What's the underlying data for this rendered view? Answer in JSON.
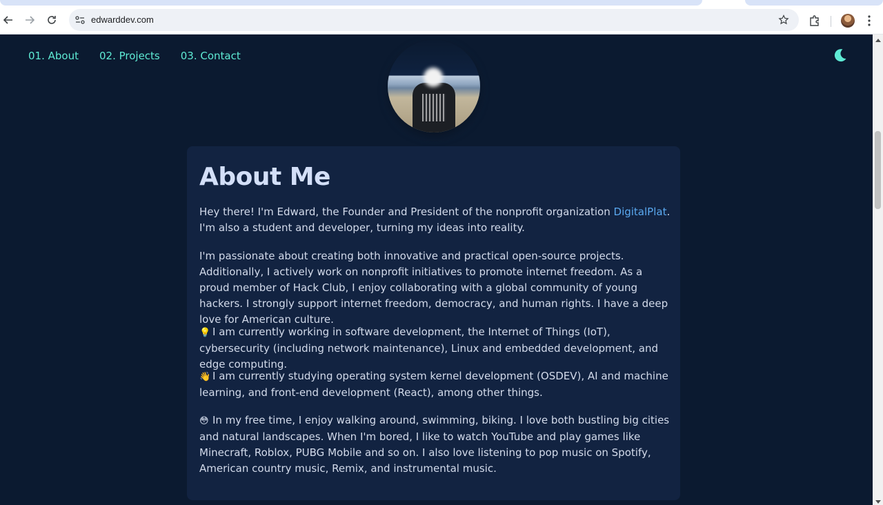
{
  "browser": {
    "url": "edwarddev.com"
  },
  "nav": {
    "items": [
      {
        "label": "01. About"
      },
      {
        "label": "02. Projects"
      },
      {
        "label": "03. Contact"
      }
    ]
  },
  "theme_toggle": {
    "icon": "moon-icon",
    "color": "#5eead4"
  },
  "about": {
    "title": "About Me",
    "p1_before": "Hey there! I'm Edward, the Founder and President of the nonprofit organization ",
    "p1_link": "DigitalPlat",
    "p1_after": ". I'm also a student and developer, turning my ideas into reality.",
    "p2": "I'm passionate about creating both innovative and practical open-source projects. Additionally, I actively work on nonprofit initiatives to promote internet freedom. As a proud member of Hack Club, I enjoy collaborating with a global community of young hackers. I strongly support internet freedom, democracy, and human rights. I have a deep love for American culture.",
    "p3_emoji": "💡",
    "p3": "I am currently working in software development, the Internet of Things (IoT), cybersecurity (including network maintenance), Linux and embedded development, and edge computing.",
    "p4_emoji": "👋",
    "p4": "I am currently studying operating system kernel development (OSDEV), AI and machine learning, and front-end development (React), among other things.",
    "p5_emoji": "😳",
    "p5": "In my free time, I enjoy walking around, swimming, biking. I love both bustling big cities and natural landscapes. When I'm bored, I like to watch YouTube and play games like Minecraft, Roblox, PUBG Mobile and so on. I also love listening to pop music on Spotify, American country music, Remix, and instrumental music."
  },
  "colors": {
    "background": "#0b1a30",
    "card": "#122341",
    "accent": "#5eead4",
    "link": "#5aa9f0"
  }
}
